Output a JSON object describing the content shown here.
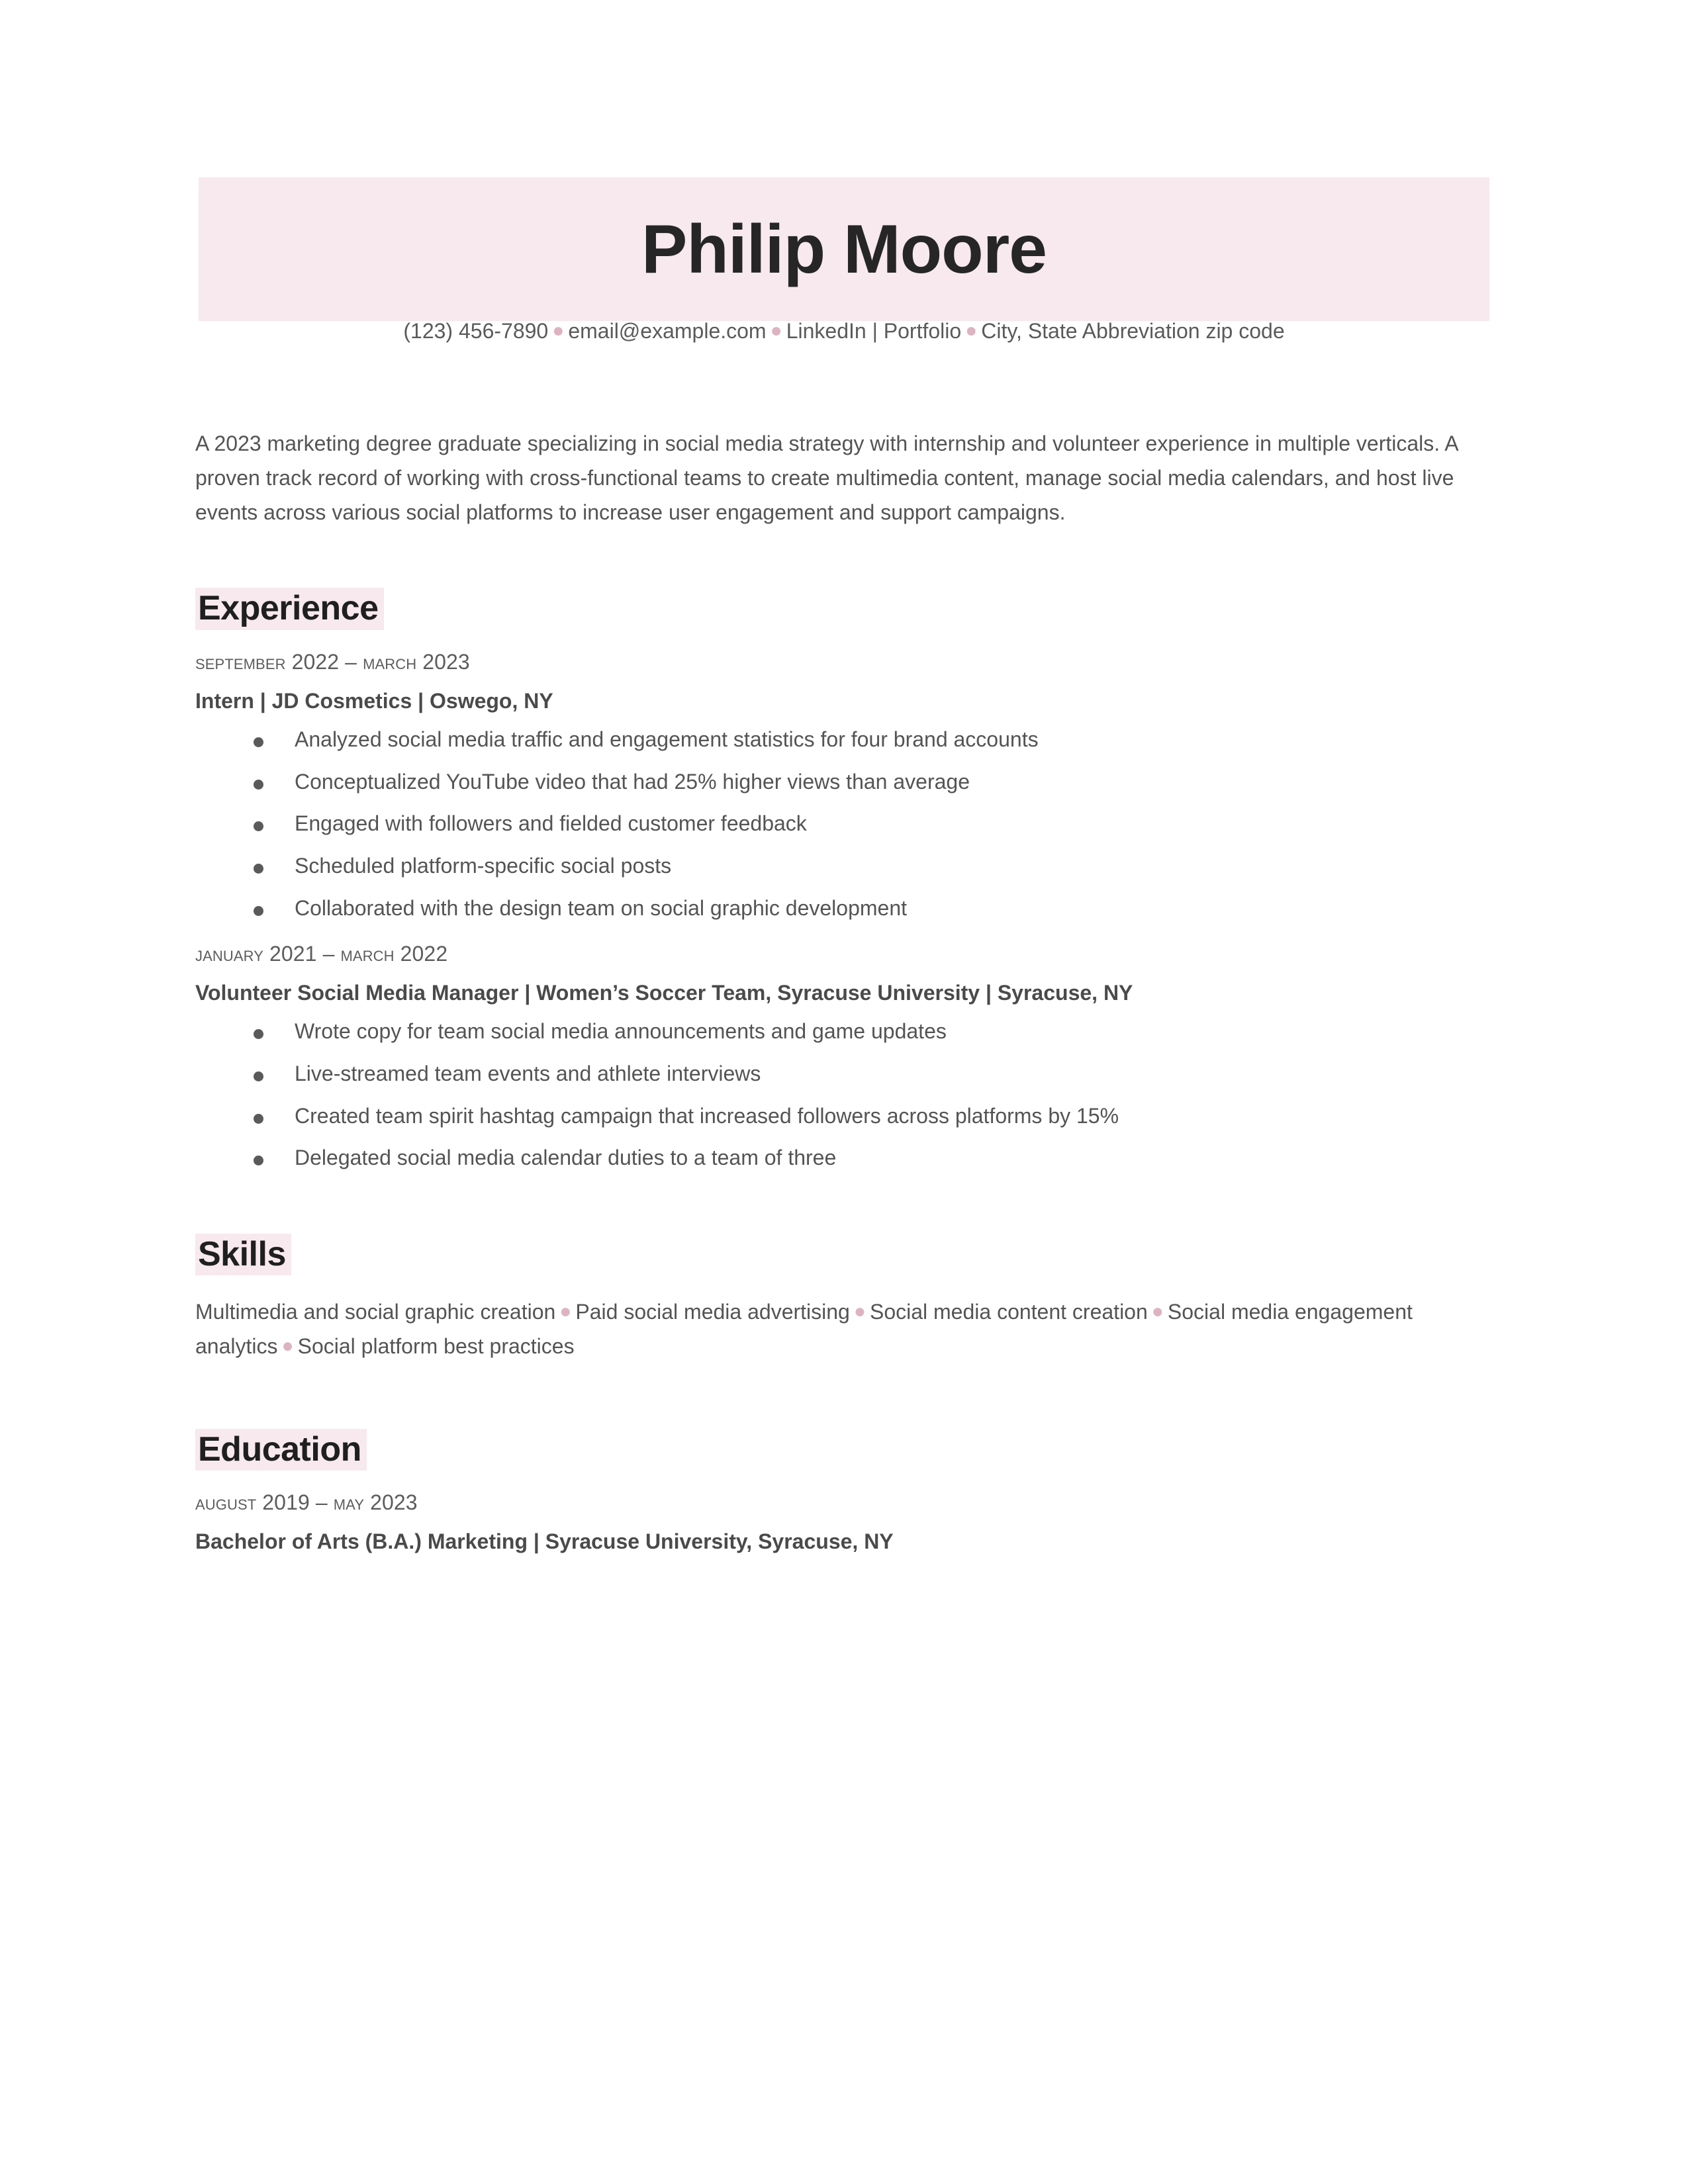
{
  "document": {
    "type": "resume",
    "accent_color": "#f7e9ed",
    "separator_color": "#ddb3c2",
    "text_color": "#545454"
  },
  "header": {
    "full_name": "Philip Moore",
    "contact": {
      "phone": "(123) 456-7890",
      "email": "email@example.com",
      "links": "LinkedIn | Portfolio",
      "location": "City, State Abbreviation zip code"
    }
  },
  "summary": {
    "text": "A 2023 marketing degree graduate specializing in social media strategy with internship and volunteer experience in multiple verticals. A proven track record of working with cross-functional teams to create multimedia content, manage social media calendars, and host live events across various social platforms to increase user engagement and support campaigns."
  },
  "experience": {
    "heading": "Experience",
    "jobs": [
      {
        "date_start": "September 2022",
        "date_end": "March 2023",
        "date_range": "September 2022 – March 2023",
        "title_line": "Intern | JD Cosmetics | Oswego, NY",
        "bullets": [
          "Analyzed social media traffic and engagement statistics for four brand accounts",
          "Conceptualized YouTube video that had 25% higher views than average",
          "Engaged with followers and fielded customer feedback",
          "Scheduled platform-specific social posts",
          "Collaborated with the design team on social graphic development"
        ]
      },
      {
        "date_start": "January 2021",
        "date_end": "March 2022",
        "date_range": "January 2021 – March 2022",
        "title_line": "Volunteer Social Media Manager | Women’s Soccer Team, Syracuse University | Syracuse, NY",
        "bullets": [
          "Wrote copy for team social media announcements and game updates",
          "Live-streamed team events and athlete interviews",
          "Created team spirit hashtag campaign that increased followers across platforms by 15%",
          "Delegated social media calendar duties to a team of three"
        ]
      }
    ]
  },
  "skills": {
    "heading": "Skills",
    "items": [
      "Multimedia and social graphic creation",
      "Paid social media advertising",
      "Social media content creation",
      "Social media engagement analytics",
      "Social platform best practices"
    ]
  },
  "education": {
    "heading": "Education",
    "entries": [
      {
        "date_start": "August 2019",
        "date_end": "May 2023",
        "date_range": "August 2019 – May 2023",
        "degree_line": "Bachelor of Arts (B.A.) Marketing | Syracuse University, Syracuse, NY"
      }
    ]
  }
}
